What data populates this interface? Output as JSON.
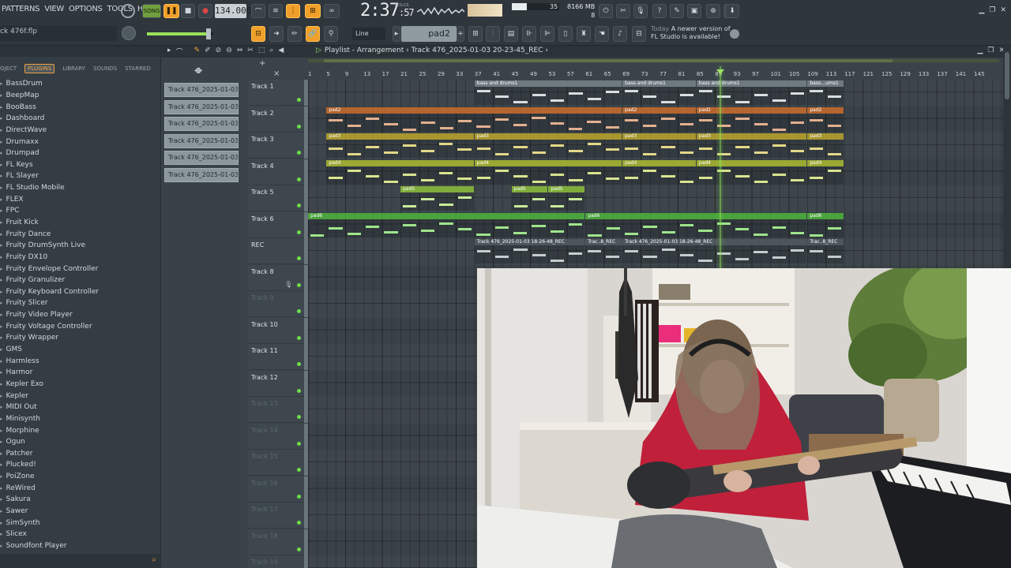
{
  "menu": [
    "PATTERNS",
    "VIEW",
    "OPTIONS",
    "TOOLS",
    "HELP"
  ],
  "hint_bar": "ck 476f.flp",
  "tempo": "134.000",
  "time": {
    "main": "2:37",
    "sub": ":57",
    "label": "M:S:CS"
  },
  "cpu": {
    "value": "35"
  },
  "memory": {
    "value": "8166 MB",
    "polyphony": "8"
  },
  "snap": "Line",
  "pattern": "pad2",
  "news": {
    "today": "Today",
    "message": "A newer version of FL Studio is available!"
  },
  "browser": {
    "tabs": [
      "OJECT",
      "PLUGINS",
      "LIBRARY",
      "SOUNDS",
      "STARRED"
    ],
    "active_tab": "PLUGINS",
    "items": [
      "BassDrum",
      "BeepMap",
      "BooBass",
      "Dashboard",
      "DirectWave",
      "Drumaxx",
      "Drumpad",
      "FL Keys",
      "FL Slayer",
      "FL Studio Mobile",
      "FLEX",
      "FPC",
      "Fruit Kick",
      "Fruity Dance",
      "Fruity DrumSynth Live",
      "Fruity DX10",
      "Fruity Envelope Controller",
      "Fruity Granulizer",
      "Fruity Keyboard Controller",
      "Fruity Slicer",
      "Fruity Video Player",
      "Fruity Voltage Controller",
      "Fruity Wrapper",
      "GMS",
      "Harmless",
      "Harmor",
      "Kepler Exo",
      "Kepler",
      "MIDI Out",
      "Minisynth",
      "Morphine",
      "Ogun",
      "Patcher",
      "Plucked!",
      "PoiZone",
      "ReWired",
      "Sakura",
      "Sawer",
      "SimSynth",
      "Slicex",
      "Soundfont Player"
    ]
  },
  "picker": [
    "Track 476_2025-01-03 1…",
    "Track 476_2025-01-03 1…",
    "Track 476_2025-01-03 1…",
    "Track 476_2025-01-03 1…",
    "Track 476_2025-01-03 2…",
    "Track 476_2025-01-03 2…"
  ],
  "playlist": {
    "title_prefix": "Playlist - Arrangement",
    "title_sep": "›",
    "title_name": "Track 476_2025-01-03 20-23-45_REC",
    "ruler": [
      "1",
      "5",
      "9",
      "13",
      "17",
      "21",
      "25",
      "29",
      "33",
      "37",
      "41",
      "45",
      "49",
      "53",
      "57",
      "61",
      "65",
      "69",
      "73",
      "77",
      "81",
      "85",
      "89",
      "93",
      "97",
      "101",
      "105",
      "109",
      "113",
      "117",
      "121",
      "125",
      "129",
      "133",
      "137",
      "141",
      "145"
    ],
    "tracks": [
      "Track 1",
      "Track 2",
      "Track 3",
      "Track 4",
      "Track 5",
      "Track 6",
      "REC",
      "Track 8",
      "Track 9",
      "Track 10",
      "Track 11",
      "Track 12",
      "Track 13",
      "Track 14",
      "Track 15",
      "Track 16",
      "Track 17",
      "Track 18",
      "Track 19"
    ],
    "dim_tracks": [
      8,
      12,
      13,
      14,
      15,
      16,
      17,
      18
    ]
  },
  "clips": [
    {
      "row": 0,
      "start": 37,
      "end": 69,
      "label": "bass and drums1",
      "color": "#6f7a80",
      "note": "#d7dde0"
    },
    {
      "row": 0,
      "start": 69,
      "end": 85,
      "label": "bass and drums1",
      "color": "#6f7a80",
      "note": "#d7dde0"
    },
    {
      "row": 0,
      "start": 85,
      "end": 109,
      "label": "bass and drums1",
      "color": "#6f7a80",
      "note": "#d7dde0"
    },
    {
      "row": 0,
      "start": 109,
      "end": 117,
      "label": "bass…ums1",
      "color": "#6f7a80",
      "note": "#d7dde0"
    },
    {
      "row": 1,
      "start": 5,
      "end": 69,
      "label": "pad2",
      "color": "#b5652f",
      "note": "#e3b090"
    },
    {
      "row": 1,
      "start": 69,
      "end": 85,
      "label": "pad2",
      "color": "#b5652f",
      "note": "#e3b090"
    },
    {
      "row": 1,
      "start": 85,
      "end": 109,
      "label": "pad2",
      "color": "#b5652f",
      "note": "#e3b090"
    },
    {
      "row": 1,
      "start": 109,
      "end": 117,
      "label": "pad2",
      "color": "#b5652f",
      "note": "#e3b090"
    },
    {
      "row": 2,
      "start": 5,
      "end": 37,
      "label": "pad3",
      "color": "#a8962e",
      "note": "#e3d88a"
    },
    {
      "row": 2,
      "start": 37,
      "end": 69,
      "label": "pad3",
      "color": "#a8962e",
      "note": "#e3d88a"
    },
    {
      "row": 2,
      "start": 69,
      "end": 85,
      "label": "pad3",
      "color": "#a8962e",
      "note": "#e3d88a"
    },
    {
      "row": 2,
      "start": 85,
      "end": 109,
      "label": "pad3",
      "color": "#a8962e",
      "note": "#e3d88a"
    },
    {
      "row": 2,
      "start": 109,
      "end": 117,
      "label": "pad3",
      "color": "#a8962e",
      "note": "#e3d88a"
    },
    {
      "row": 3,
      "start": 5,
      "end": 37,
      "label": "pad4",
      "color": "#9aa834",
      "note": "#d9e38f"
    },
    {
      "row": 3,
      "start": 37,
      "end": 69,
      "label": "pad4",
      "color": "#9aa834",
      "note": "#d9e38f"
    },
    {
      "row": 3,
      "start": 69,
      "end": 85,
      "label": "pad4",
      "color": "#9aa834",
      "note": "#d9e38f"
    },
    {
      "row": 3,
      "start": 85,
      "end": 109,
      "label": "pad4",
      "color": "#9aa834",
      "note": "#d9e38f"
    },
    {
      "row": 3,
      "start": 109,
      "end": 117,
      "label": "pad4",
      "color": "#9aa834",
      "note": "#d9e38f"
    },
    {
      "row": 4,
      "start": 21,
      "end": 37,
      "label": "pad5",
      "color": "#7fac3a",
      "note": "#c9ec9a"
    },
    {
      "row": 4,
      "start": 45,
      "end": 53,
      "label": "pad5",
      "color": "#7fac3a",
      "note": "#c9ec9a"
    },
    {
      "row": 4,
      "start": 53,
      "end": 61,
      "label": "pad5",
      "color": "#7fac3a",
      "note": "#c9ec9a"
    },
    {
      "row": 5,
      "start": 1,
      "end": 61,
      "label": "pad6",
      "color": "#4aa33c",
      "note": "#9fe58c"
    },
    {
      "row": 5,
      "start": 61,
      "end": 109,
      "label": "pad6",
      "color": "#4aa33c",
      "note": "#9fe58c"
    },
    {
      "row": 5,
      "start": 109,
      "end": 117,
      "label": "pad6",
      "color": "#4aa33c",
      "note": "#9fe58c"
    },
    {
      "row": 6,
      "start": 37,
      "end": 61,
      "label": "Track 476_2025-01-03 18-26-48_REC",
      "color": "#4d565c",
      "note": "#c5ccd0"
    },
    {
      "row": 6,
      "start": 61,
      "end": 69,
      "label": "Trac..8_REC",
      "color": "#4d565c",
      "note": "#c5ccd0"
    },
    {
      "row": 6,
      "start": 69,
      "end": 109,
      "label": "Track 476_2025-01-03 18-26-48_REC",
      "color": "#4d565c",
      "note": "#c5ccd0"
    },
    {
      "row": 6,
      "start": 109,
      "end": 117,
      "label": "Trac..8_REC",
      "color": "#4d565c",
      "note": "#c5ccd0"
    }
  ],
  "webcam": {
    "description_icon": "webcam-overlay"
  }
}
